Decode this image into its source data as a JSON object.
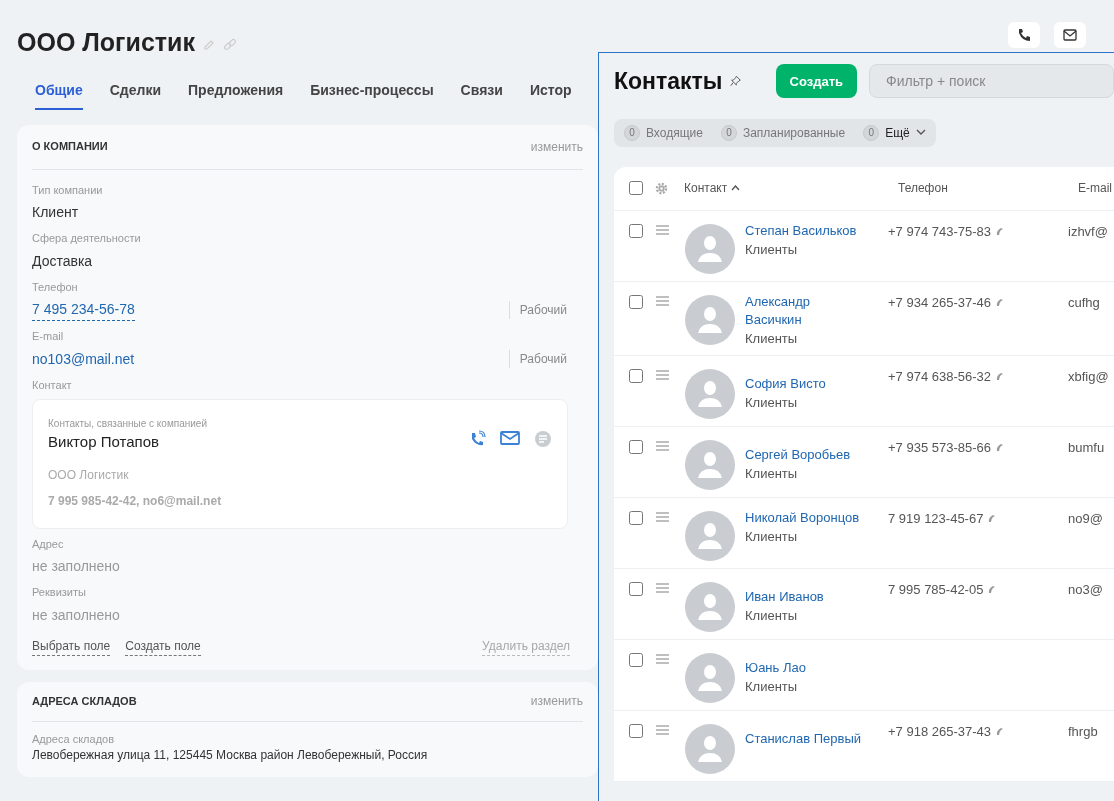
{
  "company": {
    "title": "ООО Логистик"
  },
  "tabs": [
    {
      "label": "Общие",
      "selected": true
    },
    {
      "label": "Сделки",
      "selected": false
    },
    {
      "label": "Предложения",
      "selected": false
    },
    {
      "label": "Бизнес-процессы",
      "selected": false
    },
    {
      "label": "Связи",
      "selected": false
    },
    {
      "label": "Истор",
      "selected": false
    }
  ],
  "about": {
    "heading": "О КОМПАНИИ",
    "edit": "изменить",
    "fields": [
      {
        "label": "Тип компании",
        "value": "Клиент",
        "kind": "text"
      },
      {
        "label": "Сфера деятельности",
        "value": "Доставка",
        "kind": "text"
      },
      {
        "label": "Телефон",
        "value": "7 495 234-56-78",
        "kind": "phone",
        "type": "Рабочий"
      },
      {
        "label": "E-mail",
        "value": "no103@mail.net",
        "kind": "email",
        "type": "Рабочий"
      }
    ],
    "contact": {
      "label": "Контакт",
      "caption": "Контакты, связанные с компанией",
      "name": "Виктор Потапов",
      "company": "ООО Логистик",
      "details": "7 995 985-42-42, no6@mail.net"
    },
    "empty_fields": [
      {
        "label": "Адрес",
        "value": "не заполнено"
      },
      {
        "label": "Реквизиты",
        "value": "не заполнено"
      }
    ],
    "actions": [
      "Выбрать поле",
      "Создать поле"
    ],
    "delete": "Удалить раздел"
  },
  "warehouses": {
    "heading": "АДРЕСА СКЛАДОВ",
    "edit": "изменить",
    "label": "Адреса складов",
    "value": "Левобережная улица 11, 125445 Москва район Левобережный, Россия"
  },
  "contacts_panel": {
    "title": "Контакты",
    "create": "Создать",
    "search": {
      "placeholder": "Фильтр + поиск"
    },
    "counters": [
      {
        "count": "0",
        "label": "Входящие"
      },
      {
        "count": "0",
        "label": "Запланированные"
      },
      {
        "count": "0",
        "label": "Ещё"
      }
    ],
    "table": {
      "all_checked": false,
      "columns": [
        "Контакт",
        "Телефон",
        "E-mail"
      ],
      "rows": [
        {
          "name": "Степан Васильков",
          "group": "Клиенты",
          "phone": "+7 974 743-75-83",
          "email": "izhvf@",
          "checked": false
        },
        {
          "name": "Александр Васичкин",
          "group": "Клиенты",
          "phone": "+7 934 265-37-46",
          "email": "cufhg",
          "checked": false
        },
        {
          "name": "София Висто",
          "group": "Клиенты",
          "phone": "+7 974 638-56-32",
          "email": "xbfig@",
          "checked": false
        },
        {
          "name": "Сергей Воробьев",
          "group": "Клиенты",
          "phone": "+7 935 573-85-66",
          "email": "bumfu",
          "checked": false
        },
        {
          "name": "Николай Воронцов",
          "group": "Клиенты",
          "phone": "7 919 123-45-67",
          "email": "no9@",
          "checked": false
        },
        {
          "name": "Иван Иванов",
          "group": "Клиенты",
          "phone": "7 995 785-42-05",
          "email": "no3@",
          "checked": false
        },
        {
          "name": "Юань Лао",
          "group": "Клиенты",
          "checked": false
        },
        {
          "name": "Станислав Первый",
          "phone": "+7 918 265-37-43",
          "email": "fhrgb",
          "checked": false
        }
      ]
    }
  }
}
